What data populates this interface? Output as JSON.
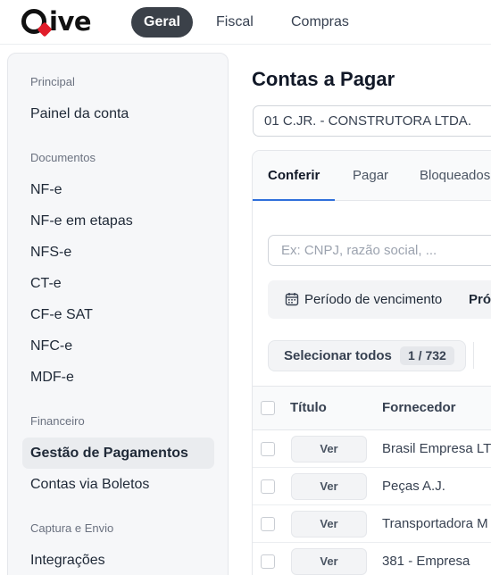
{
  "brand": {
    "name": "ive",
    "accent": "#e11d2a"
  },
  "top_tabs": [
    {
      "label": "Geral",
      "active": true
    },
    {
      "label": "Fiscal",
      "active": false
    },
    {
      "label": "Compras",
      "active": false
    }
  ],
  "sidebar": {
    "sections": [
      {
        "title": "Principal",
        "items": [
          {
            "label": "Painel da conta"
          }
        ]
      },
      {
        "title": "Documentos",
        "items": [
          {
            "label": "NF-e"
          },
          {
            "label": "NF-e em etapas"
          },
          {
            "label": "NFS-e"
          },
          {
            "label": "CT-e"
          },
          {
            "label": "CF-e SAT"
          },
          {
            "label": "NFC-e"
          },
          {
            "label": "MDF-e"
          }
        ]
      },
      {
        "title": "Financeiro",
        "items": [
          {
            "label": "Gestão de Pagamentos",
            "active": true
          },
          {
            "label": "Contas via Boletos"
          }
        ]
      },
      {
        "title": "Captura e Envio",
        "items": [
          {
            "label": "Integrações"
          }
        ]
      }
    ]
  },
  "main": {
    "title": "Contas a Pagar",
    "company": "01 C.JR. - CONSTRUTORA LTDA.",
    "tabs": [
      {
        "label": "Conferir",
        "active": true
      },
      {
        "label": "Pagar"
      },
      {
        "label": "Bloqueados"
      }
    ],
    "search": {
      "placeholder": "Ex: CNPJ, razão social, ..."
    },
    "filter": {
      "icon": "calendar-icon",
      "label": "Período de vencimento",
      "next": "Pró"
    },
    "select_all": {
      "label": "Selecionar todos",
      "count": "1 / 732"
    },
    "table": {
      "headers": {
        "title": "Título",
        "supplier": "Fornecedor"
      },
      "rows": [
        {
          "action": "Ver",
          "supplier": "Brasil Empresa LT"
        },
        {
          "action": "Ver",
          "supplier": "Peças A.J."
        },
        {
          "action": "Ver",
          "supplier": "Transportadora M"
        },
        {
          "action": "Ver",
          "supplier": "381 - Empresa"
        }
      ]
    }
  }
}
